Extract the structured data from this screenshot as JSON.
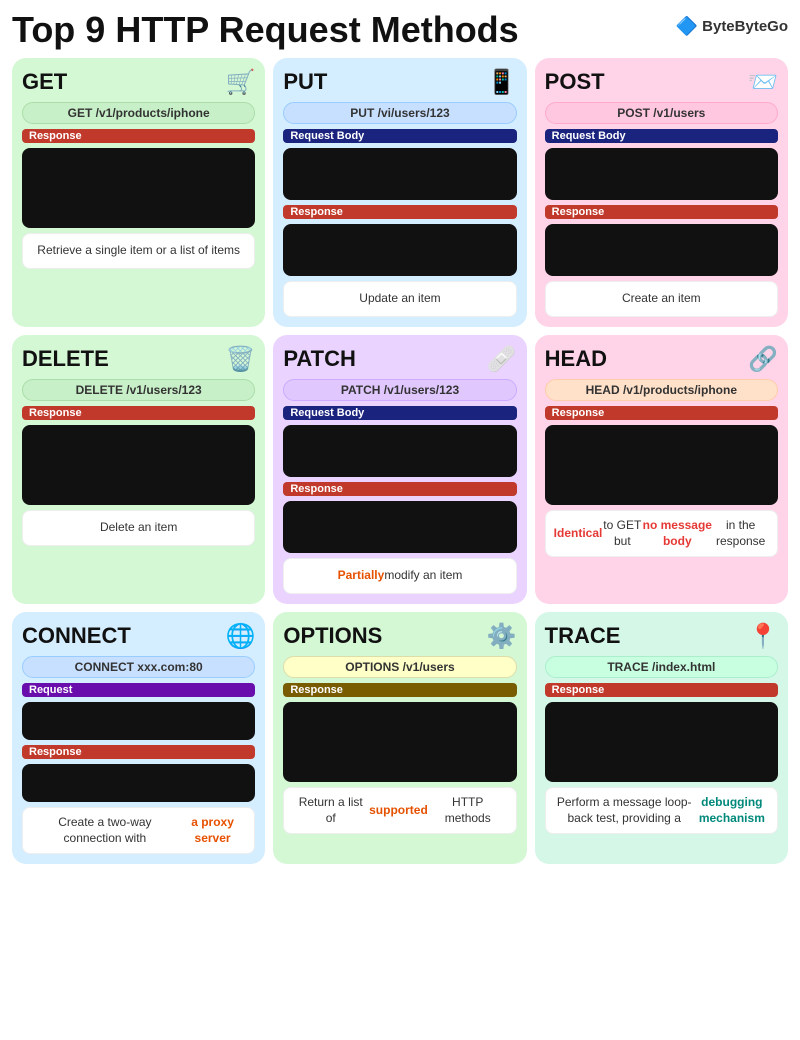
{
  "page": {
    "title": "Top 9 HTTP Request Methods",
    "brand": "ByteByteGo"
  },
  "cards": [
    {
      "id": "get",
      "title": "GET",
      "icon": "🛒",
      "url": "GET  /v1/products/iphone",
      "sections": [
        {
          "type": "response",
          "label": "Response",
          "box_size": "lg"
        }
      ],
      "description": "Retrieve a single item or a list of items",
      "desc_style": "normal"
    },
    {
      "id": "put",
      "title": "PUT",
      "icon": "📱",
      "url": "PUT  /vi/users/123",
      "sections": [
        {
          "type": "request_body",
          "label": "Request Body",
          "box_size": "md"
        },
        {
          "type": "response",
          "label": "Response",
          "box_size": "md"
        }
      ],
      "description": "Update an item",
      "desc_style": "normal"
    },
    {
      "id": "post",
      "title": "POST",
      "icon": "📨",
      "url": "POST  /v1/users",
      "sections": [
        {
          "type": "request_body",
          "label": "Request Body",
          "box_size": "md"
        },
        {
          "type": "response",
          "label": "Response",
          "box_size": "md"
        }
      ],
      "description": "Create an item",
      "desc_style": "normal"
    },
    {
      "id": "delete",
      "title": "DELETE",
      "icon": "🗑️",
      "url": "DELETE  /v1/users/123",
      "sections": [
        {
          "type": "response",
          "label": "Response",
          "box_size": "lg"
        }
      ],
      "description": "Delete an item",
      "desc_style": "normal"
    },
    {
      "id": "patch",
      "title": "PATCH",
      "icon": "🩹",
      "url": "PATCH  /v1/users/123",
      "sections": [
        {
          "type": "request_body",
          "label": "Request Body",
          "box_size": "md"
        },
        {
          "type": "response",
          "label": "Response",
          "box_size": "md"
        }
      ],
      "description_parts": [
        {
          "text": "Partially",
          "style": "orange"
        },
        {
          "text": " modify an item",
          "style": "normal"
        }
      ],
      "desc_style": "mixed"
    },
    {
      "id": "head",
      "title": "HEAD",
      "icon": "🔗",
      "url": "HEAD  /v1/products/iphone",
      "sections": [
        {
          "type": "response",
          "label": "Response",
          "box_size": "lg"
        }
      ],
      "description_parts": [
        {
          "text": "Identical",
          "style": "red"
        },
        {
          "text": " to GET but ",
          "style": "normal"
        },
        {
          "text": "no message body",
          "style": "red"
        },
        {
          "text": " in the response",
          "style": "normal"
        }
      ],
      "desc_style": "mixed"
    },
    {
      "id": "connect",
      "title": "CONNECT",
      "icon": "🌐",
      "url": "CONNECT  xxx.com:80",
      "sections": [
        {
          "type": "request",
          "label": "Request",
          "box_size": "sm"
        },
        {
          "type": "response",
          "label": "Response",
          "box_size": "sm"
        }
      ],
      "description_parts": [
        {
          "text": "Create a two-way connection with ",
          "style": "normal"
        },
        {
          "text": "a proxy server",
          "style": "orange"
        }
      ],
      "desc_style": "mixed"
    },
    {
      "id": "options",
      "title": "OPTIONS",
      "icon": "⚙️",
      "url": "OPTIONS  /v1/users",
      "sections": [
        {
          "type": "response_options",
          "label": "Response",
          "box_size": "lg"
        }
      ],
      "description_parts": [
        {
          "text": "Return a list of ",
          "style": "normal"
        },
        {
          "text": "supported",
          "style": "orange"
        },
        {
          "text": " HTTP methods",
          "style": "normal"
        }
      ],
      "desc_style": "mixed"
    },
    {
      "id": "trace",
      "title": "TRACE",
      "icon": "📍",
      "url": "TRACE  /index.html",
      "sections": [
        {
          "type": "response",
          "label": "Response",
          "box_size": "lg"
        }
      ],
      "description_parts": [
        {
          "text": "Perform a message loop-back test, providing a ",
          "style": "normal"
        },
        {
          "text": "debugging mechanism",
          "style": "teal"
        }
      ],
      "desc_style": "mixed"
    }
  ]
}
